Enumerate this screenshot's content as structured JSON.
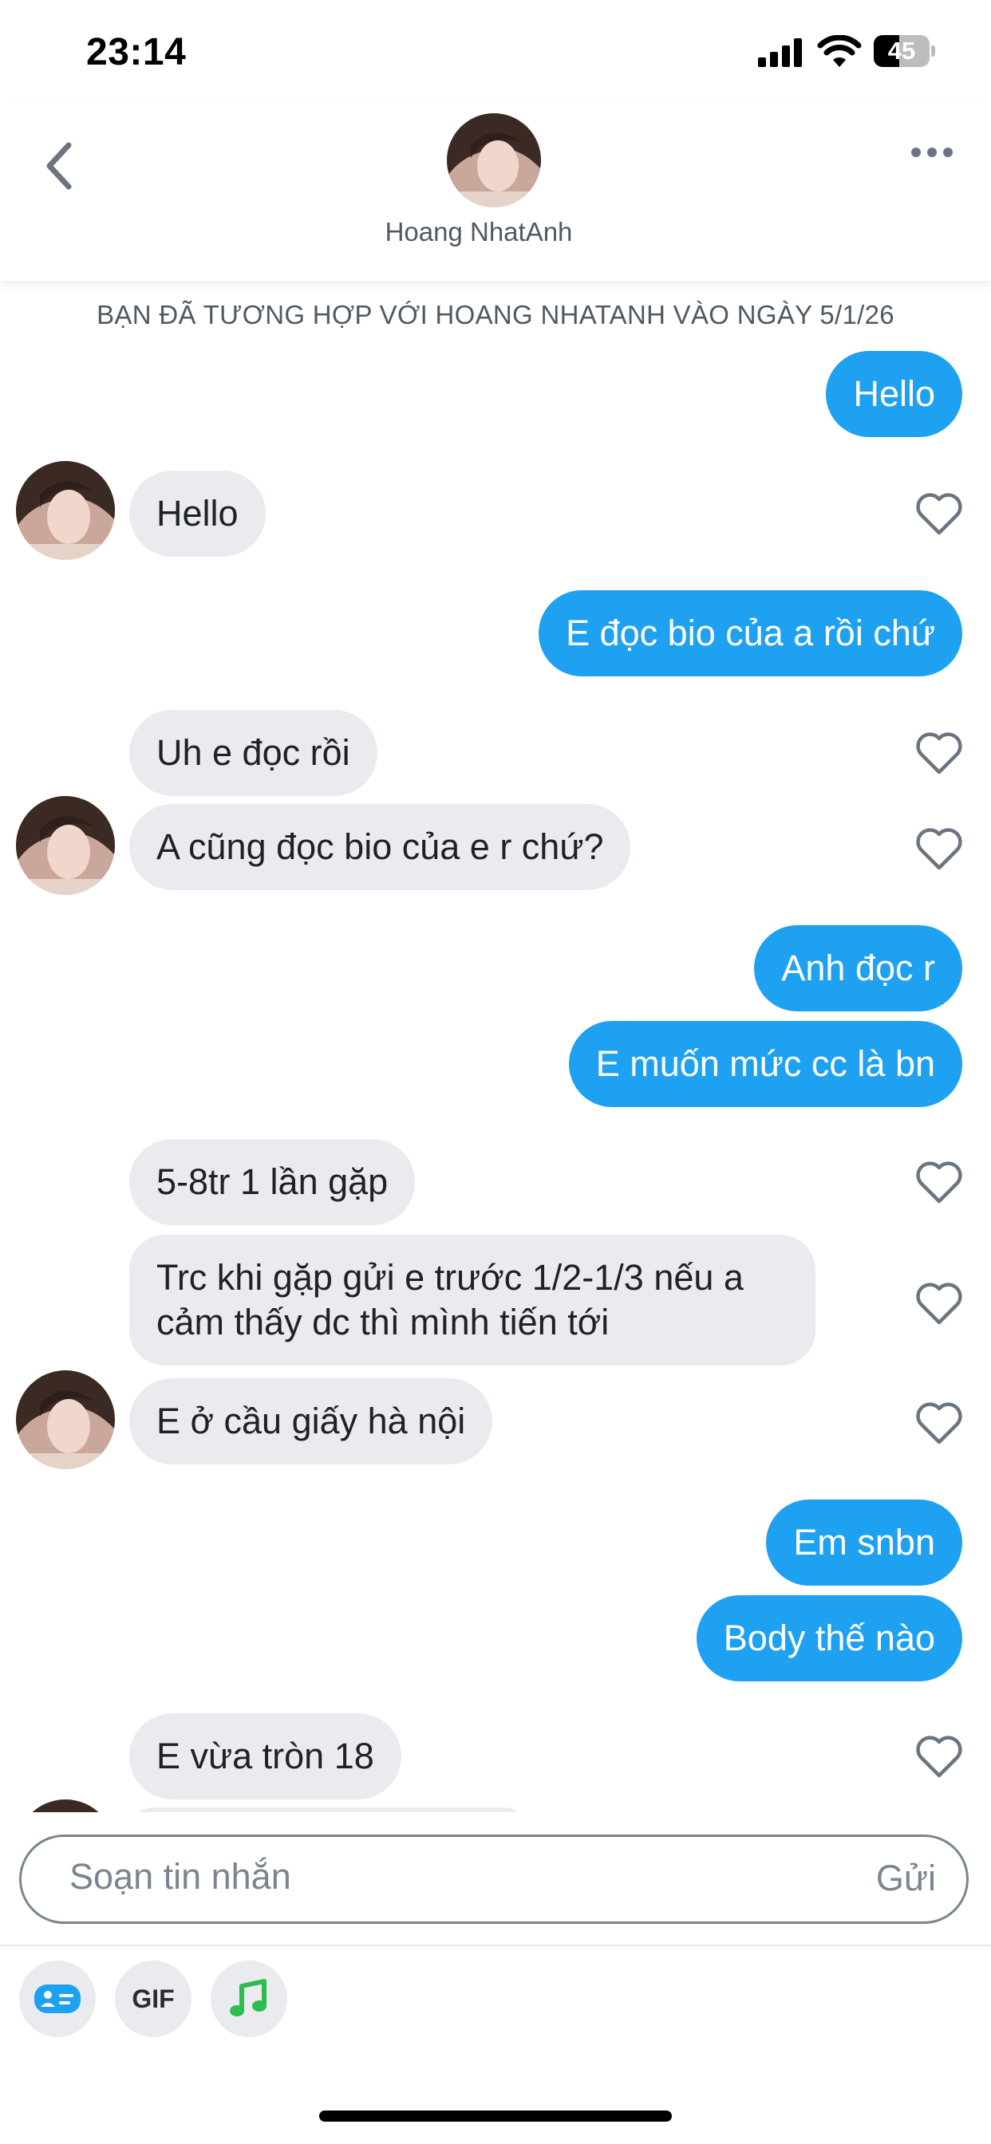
{
  "status_bar": {
    "time": "23:14",
    "battery": "45",
    "battery_level": 0.45
  },
  "header": {
    "name": "Hoang NhatAnh",
    "back_icon": "chevron-left-icon",
    "more_icon": "more-dots-icon"
  },
  "chat": {
    "match_banner": "BẠN ĐÃ TƯƠNG HỢP VỚI HOANG NHATANH VÀO NGÀY 5/1/26",
    "messages": [
      {
        "from": "me",
        "text": "Hello"
      },
      {
        "from": "them",
        "text": "Hello"
      },
      {
        "from": "me",
        "text": "E đọc bio của a rồi chứ"
      },
      {
        "from": "them",
        "text": "Uh e đọc rồi"
      },
      {
        "from": "them",
        "text": "A cũng đọc bio của e r chứ?"
      },
      {
        "from": "me",
        "text": "Anh đọc r"
      },
      {
        "from": "me",
        "text": "E muốn mức cc là bn"
      },
      {
        "from": "them",
        "text": "5-8tr 1 lần gặp"
      },
      {
        "from": "them",
        "text": "Trc khi gặp gửi e trước 1/2-1/3 nếu a cảm thấy dc thì mình tiến tới"
      },
      {
        "from": "them",
        "text": "E ở cầu giấy hà nội"
      },
      {
        "from": "me",
        "text": "Em snbn"
      },
      {
        "from": "me",
        "text": "Body thế nào"
      },
      {
        "from": "them",
        "text": "E vừa tròn 18"
      }
    ]
  },
  "composer": {
    "placeholder": "Soạn tin nhắn",
    "send_label": "Gửi",
    "tools": [
      {
        "icon": "id-card-icon"
      },
      {
        "label": "GIF"
      },
      {
        "icon": "music-note-icon"
      }
    ]
  },
  "colors": {
    "outgoing": "#1ea1f1",
    "incoming": "#eaebef",
    "music": "#2dbd4e"
  }
}
